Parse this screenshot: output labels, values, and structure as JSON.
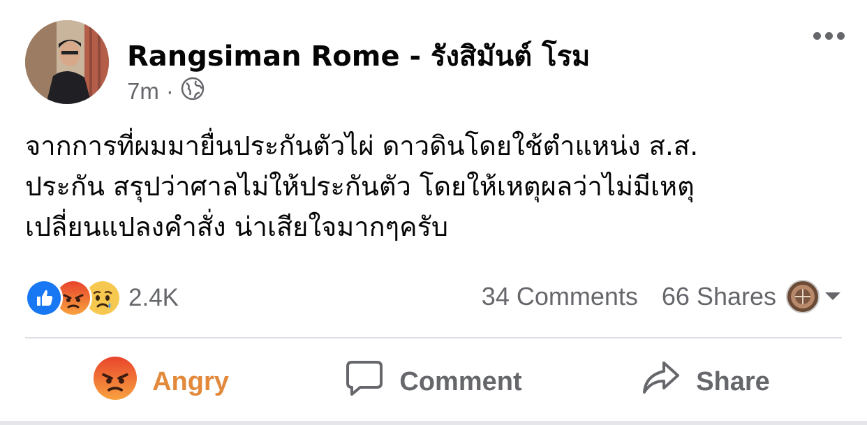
{
  "post": {
    "author": "Rangsiman Rome - รังสิมันต์ โรม",
    "time": "7m",
    "separator": "·",
    "audience_icon": "globe-icon",
    "text_lines": [
      "จากการที่ผมมายื่นประกันตัวไผ่ ดาวดินโดยใช้ตำแหน่ง ส.ส.",
      "ประกัน สรุปว่าศาลไม่ให้ประกันตัว โดยให้เหตุผลว่าไม่มีเหตุ",
      "เปลี่ยนแปลงคำสั่ง น่าเสียใจมากๆครับ"
    ]
  },
  "reactions": {
    "icons": [
      "like-icon",
      "angry-icon",
      "sad-icon"
    ],
    "count": "2.4K"
  },
  "stats": {
    "comments": "34 Comments",
    "shares": "66 Shares"
  },
  "actions": {
    "react_label": "Angry",
    "comment_label": "Comment",
    "share_label": "Share"
  },
  "colors": {
    "angry_accent": "#e2893c",
    "like_blue": "#1877f2",
    "muted_text": "#65676b"
  }
}
